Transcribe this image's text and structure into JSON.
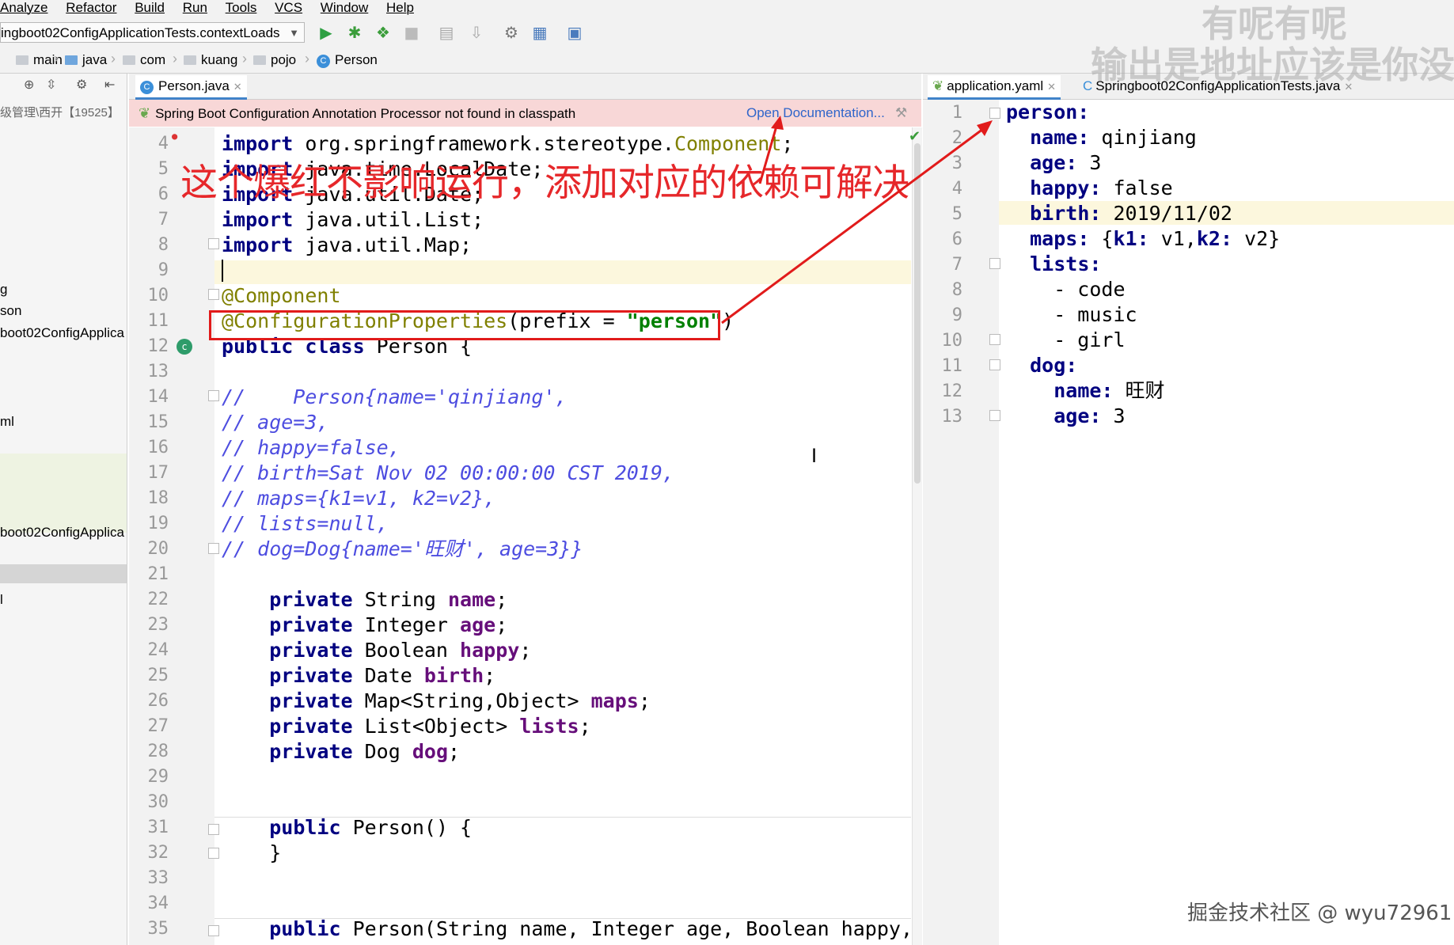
{
  "menubar": {
    "items": [
      "Analyze",
      "Refactor",
      "Build",
      "Run",
      "Tools",
      "VCS",
      "Window",
      "Help"
    ]
  },
  "toolbar": {
    "run_config": "ingboot02ConfigApplicationTests.contextLoads",
    "icons": [
      "run-icon",
      "debug-icon",
      "coverage-icon",
      "stop-icon",
      "build-icon",
      "deploy-icon",
      "project-structure-icon",
      "sdk-icon",
      "vcs-icon"
    ]
  },
  "breadcrumb": {
    "items": [
      "main",
      "java",
      "com",
      "kuang",
      "pojo",
      "Person"
    ]
  },
  "project_panel": {
    "header_fragment": "级管理\\西开【19525】",
    "rows": [
      "g",
      "son",
      "boot02ConfigApplica",
      "ml",
      "boot02ConfigApplica",
      "l"
    ]
  },
  "left_editor": {
    "tab": "Person.java",
    "banner_text": "Spring Boot Configuration Annotation Processor not found in classpath",
    "banner_link": "Open Documentation...",
    "line_numbers": [
      "4",
      "5",
      "6",
      "7",
      "8",
      "9",
      "10",
      "11",
      "12",
      "13",
      "14",
      "15",
      "16",
      "17",
      "18",
      "19",
      "20",
      "21",
      "22",
      "23",
      "24",
      "25",
      "26",
      "27",
      "28",
      "29",
      "30",
      "31",
      "32",
      "33",
      "34",
      "35"
    ]
  },
  "right_editor": {
    "tabs": [
      "application.yaml",
      "Springboot02ConfigApplicationTests.java"
    ],
    "line_numbers": [
      "1",
      "2",
      "3",
      "4",
      "5",
      "6",
      "7",
      "8",
      "9",
      "10",
      "11",
      "12",
      "13"
    ]
  },
  "overlay": {
    "caption": "这个爆红不影响运行，添加对应的依赖可解决",
    "watermark_top": "有呢有呢",
    "watermark_bottom": "输出是地址应该是你没有",
    "credit": "掘金技术社区 @ wyu72961"
  }
}
